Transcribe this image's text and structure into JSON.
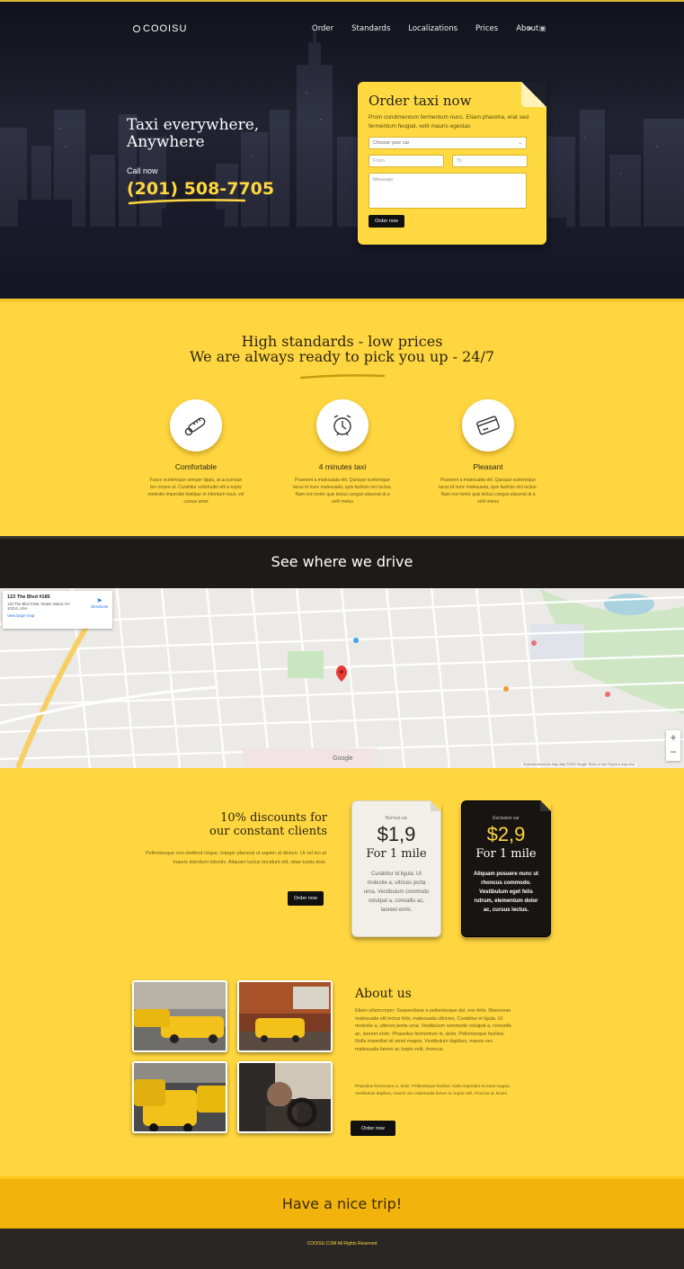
{
  "header": {
    "logo": "COOISU",
    "nav": [
      "Order",
      "Standards",
      "Localizations",
      "Prices",
      "About"
    ],
    "icons": [
      "user-icon",
      "cart-icon"
    ]
  },
  "hero": {
    "title_line1": "Taxi everywhere,",
    "title_line2": "Anywhere",
    "call_label": "Call now",
    "phone": "(201) 508-7705"
  },
  "order_form": {
    "title": "Order taxi now",
    "text": "Proin condimentum fermentum nunc. Etiam pharetra, erat sed fermentum feugiat, velit mauris egestas",
    "car_select": "Choose your car",
    "from_placeholder": "From",
    "to_placeholder": "To",
    "message_placeholder": "Message",
    "button": "Order now"
  },
  "standards": {
    "title_line1": "High standards - low prices",
    "title_line2": "We are always ready to pick you up - 24/7",
    "features": [
      {
        "icon": "thermometer-icon",
        "title": "Comfortable",
        "text": "Fusce scelerisque semper ligula, at accumsan leo ornare at. Curabitur sollicitudin elit a turpis molestie imperdiet tristique et interdum risus, vel cursus amet"
      },
      {
        "icon": "alarm-clock-icon",
        "title": "4 minutes taxi",
        "text": "Praesent a malesuada elit. Quisque scelerisque lacus id nunc malesuada, quis facilisis orci luctus. Nam non tortor quis lectus congue placerat at a velit metus"
      },
      {
        "icon": "credit-card-icon",
        "title": "Pleasant",
        "text": "Praesent a malesuada elit. Quisque scelerisque lacus id nunc malesuada, quis facilisis orci luctus. Nam non tortor quis lectus congue placerat at a velit metus"
      }
    ]
  },
  "drive": {
    "title": "See where we drive"
  },
  "map": {
    "card_title": "123 The Blvd #185",
    "card_address": "123 The Blvd #185, Staten Island, NY 10314, USA",
    "card_link": "View larger map",
    "directions": "Directions",
    "google": "Google",
    "footer": "Keyboard shortcuts   Map data ©2022 Google   Terms of Use   Report a map error",
    "zoom_in": "+",
    "zoom_out": "−"
  },
  "discounts": {
    "title_line1": "10% discounts for",
    "title_line2": "our constant clients",
    "text": "Pellentesque non eleifend risque. Integer placerat ut sapien at dictum. Ut vel leo at mauris interdum lobortis. Aliquam luctus tincidunt elit, vitae turpis duis.",
    "button": "Order now"
  },
  "prices": [
    {
      "label": "Normal car",
      "value": "$1,9",
      "unit": "For 1 mile",
      "text": "Curabitur id ligula. Ut molestie a, ultrices porta urna. Vestibulum commodo volutpat a, convallis ac, laoreet enim."
    },
    {
      "label": "Exclusive car",
      "value": "$2,9",
      "unit": "For 1 mile",
      "text": "Aliquam posuere nunc ut rhoncus commodo. Vestibulum eget felis rutrum, elementum dolor ac, cursus lectus."
    }
  ],
  "about": {
    "title": "About us",
    "text": "Etiam ullamcorper. Suspendisse a pellentesque dui, non felis. Maecenas malesuada elit lectus felis, malesuada ultricies. Curabitur et ligula. Ut molestie a, ultrices porta urna. Vestibulum commodo volutpat a, convallis ac, laoreet enim. Phasellus fermentum in, dolor. Pellentesque facilisis. Nulla imperdiet sit amet magna. Vestibulum dapibus, mauris nec malesuada fames ac turpis velit, rhoncus.",
    "text2": "Phasellus fermentum in, dolor. Pellentesque facilisis. Nulla imperdiet sit amet magna. Vestibulum dapibus, mauris nec malesuada fames ac turpis velit, rhoncus ac luctus.",
    "button": "Order now"
  },
  "bottom": {
    "title": "Have a nice trip!"
  },
  "footer": {
    "text": "COOISU.COM All Rights Reserved"
  },
  "colors": {
    "accent": "#ffd640",
    "dark": "#1e1a18",
    "footer": "#2a2624"
  }
}
